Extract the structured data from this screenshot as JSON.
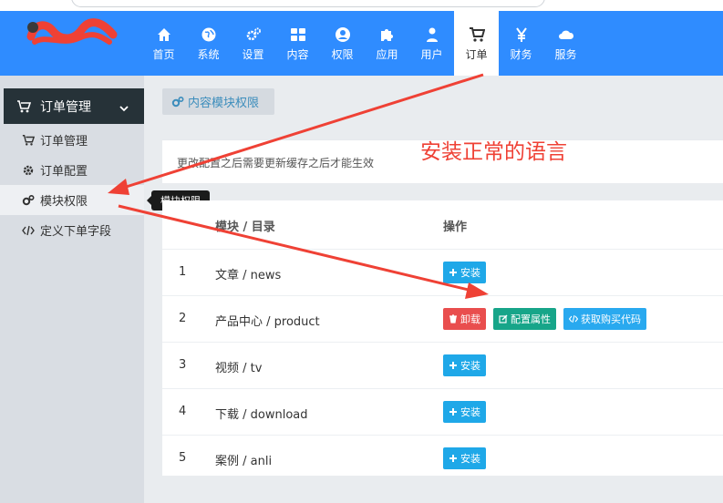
{
  "nav": [
    {
      "id": "home",
      "label": "首页",
      "icon": "home-icon"
    },
    {
      "id": "system",
      "label": "系统",
      "icon": "globe-icon"
    },
    {
      "id": "settings",
      "label": "设置",
      "icon": "gears-icon"
    },
    {
      "id": "content",
      "label": "内容",
      "icon": "grid-icon"
    },
    {
      "id": "permission",
      "label": "权限",
      "icon": "user-circle-icon"
    },
    {
      "id": "apps",
      "label": "应用",
      "icon": "puzzle-icon"
    },
    {
      "id": "users",
      "label": "用户",
      "icon": "user-icon"
    },
    {
      "id": "orders",
      "label": "订单",
      "icon": "cart-icon",
      "active": true
    },
    {
      "id": "finance",
      "label": "财务",
      "icon": "yen-icon"
    },
    {
      "id": "service",
      "label": "服务",
      "icon": "cloud-icon"
    }
  ],
  "sidebar": {
    "header": {
      "label": "订单管理",
      "icon": "cart-icon"
    },
    "items": [
      {
        "label": "订单管理",
        "icon": "cart-icon"
      },
      {
        "label": "订单配置",
        "icon": "gear-icon"
      },
      {
        "label": "模块权限",
        "icon": "gears-icon",
        "active": true
      },
      {
        "label": "定义下单字段",
        "icon": "code-icon"
      }
    ],
    "tooltip": "模块权限"
  },
  "main": {
    "crumb_label": "内容模块权限",
    "notice": "更改配置之后需要更新缓存之后才能生效",
    "annotation": "安装正常的语言",
    "table": {
      "headers": [
        "模块 / 目录",
        "操作"
      ],
      "rows": [
        {
          "num": "1",
          "name": "文章 / news",
          "actions": [
            "install"
          ]
        },
        {
          "num": "2",
          "name": "产品中心 / product",
          "actions": [
            "uninstall",
            "config",
            "code"
          ]
        },
        {
          "num": "3",
          "name": "视频 / tv",
          "actions": [
            "install"
          ]
        },
        {
          "num": "4",
          "name": "下载 / download",
          "actions": [
            "install"
          ]
        },
        {
          "num": "5",
          "name": "案例 / anli",
          "actions": [
            "install"
          ]
        }
      ]
    },
    "actions": {
      "install": "安装",
      "uninstall": "卸载",
      "config": "配置属性",
      "code": "获取购买代码"
    }
  },
  "colors": {
    "header": "#2f8cff",
    "annotation": "#ef4135"
  }
}
